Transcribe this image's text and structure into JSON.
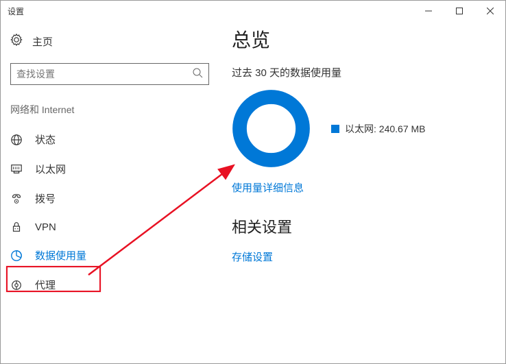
{
  "window": {
    "title": "设置"
  },
  "sidebar": {
    "home_label": "主页",
    "search_placeholder": "查找设置",
    "section_title": "网络和 Internet",
    "items": [
      {
        "label": "状态",
        "icon": "status-icon"
      },
      {
        "label": "以太网",
        "icon": "ethernet-icon"
      },
      {
        "label": "拨号",
        "icon": "dialup-icon"
      },
      {
        "label": "VPN",
        "icon": "vpn-icon"
      },
      {
        "label": "数据使用量",
        "icon": "data-usage-icon"
      },
      {
        "label": "代理",
        "icon": "proxy-icon"
      }
    ]
  },
  "main": {
    "overview_title": "总览",
    "subtitle": "过去 30 天的数据使用量",
    "legend_label": "以太网: 240.67 MB",
    "details_link": "使用量详细信息",
    "related_title": "相关设置",
    "storage_link": "存储设置"
  },
  "chart_data": {
    "type": "pie",
    "title": "过去 30 天的数据使用量",
    "series": [
      {
        "name": "以太网",
        "value": 240.67,
        "unit": "MB",
        "color": "#0078d7"
      }
    ]
  },
  "colors": {
    "accent": "#0078d7",
    "annotation": "#e81123"
  }
}
